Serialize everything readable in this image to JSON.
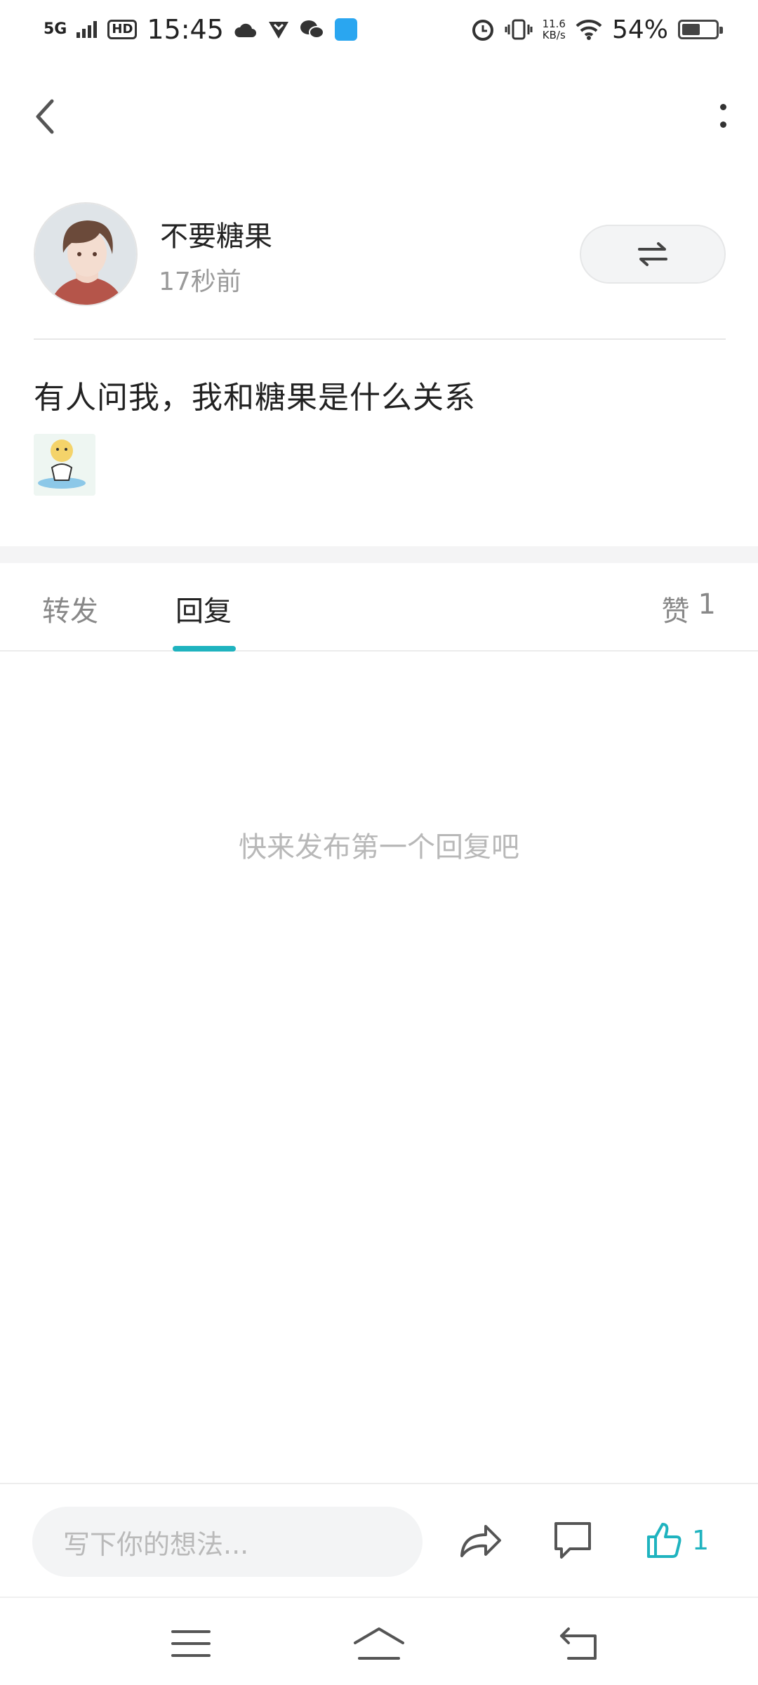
{
  "status_bar": {
    "network": "5G",
    "hd": "HD",
    "time": "15:45",
    "net_speed_value": "11.6",
    "net_speed_unit": "KB/s",
    "battery": "54%",
    "battery_level": 0.54
  },
  "post": {
    "author_name": "不要糖果",
    "time_ago": "17秒前",
    "text": "有人问我，我和糖果是什么关系"
  },
  "tabs": {
    "forward": "转发",
    "reply": "回复",
    "like_label": "赞",
    "like_count": "1",
    "active": "回复"
  },
  "empty_hint": "快来发布第一个回复吧",
  "action_bar": {
    "input_placeholder": "写下你的想法...",
    "like_count": "1"
  },
  "colors": {
    "accent": "#1fb3bf",
    "muted_text": "#9a9a9a",
    "divider": "#e7e7e7"
  }
}
